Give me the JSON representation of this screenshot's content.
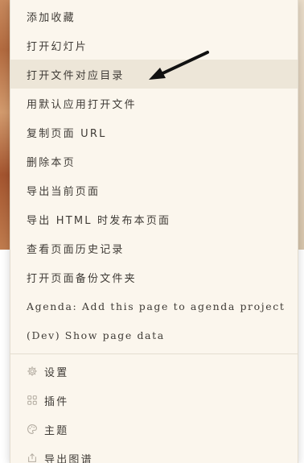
{
  "menu": {
    "items": [
      {
        "label": "添加收藏"
      },
      {
        "label": "打开幻灯片"
      },
      {
        "label": "打开文件对应目录"
      },
      {
        "label": "用默认应用打开文件"
      },
      {
        "label": "复制页面 URL"
      },
      {
        "label": "删除本页"
      },
      {
        "label": "导出当前页面"
      },
      {
        "label": "导出 HTML 时发布本页面"
      },
      {
        "label": "查看页面历史记录"
      },
      {
        "label": "打开页面备份文件夹"
      },
      {
        "label": "Agenda: Add this page to agenda project"
      },
      {
        "label": "(Dev) Show page data"
      }
    ],
    "settings_items": [
      {
        "label": "设置",
        "icon": "gear-icon"
      },
      {
        "label": "插件",
        "icon": "plugins-icon"
      },
      {
        "label": "主题",
        "icon": "palette-icon"
      },
      {
        "label": "导出图谱",
        "icon": "export-icon"
      }
    ]
  },
  "colors": {
    "menu_background": "#fbf6ed",
    "highlight": "#ede6d8",
    "text": "#3f3b36"
  }
}
